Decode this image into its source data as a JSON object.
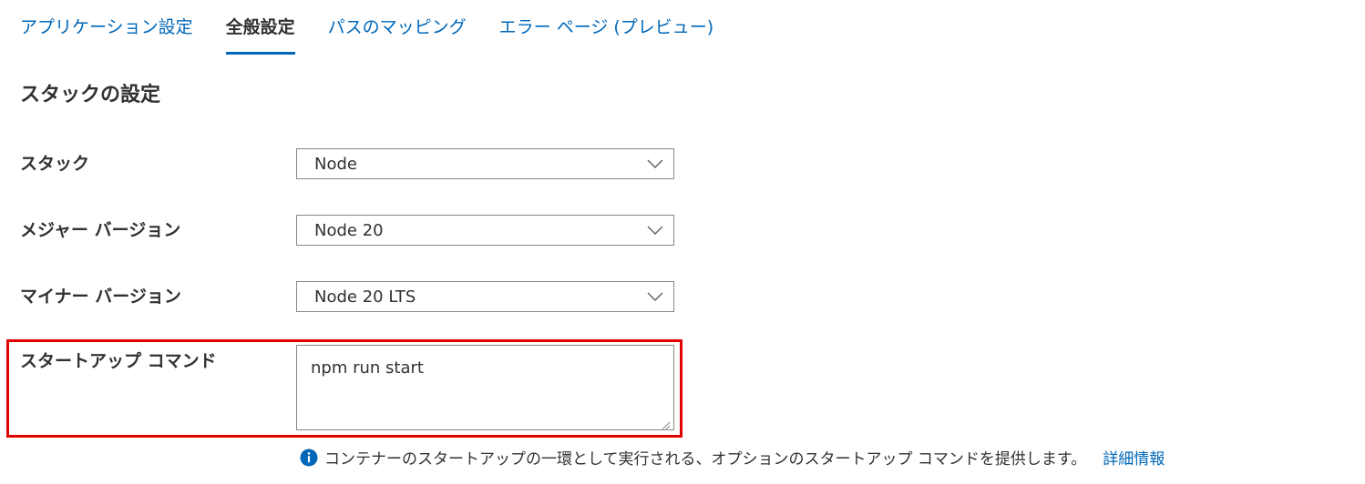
{
  "tabs": [
    {
      "label": "アプリケーション設定",
      "active": false
    },
    {
      "label": "全般設定",
      "active": true
    },
    {
      "label": "パスのマッピング",
      "active": false
    },
    {
      "label": "エラー ページ (プレビュー)",
      "active": false
    }
  ],
  "section_title": "スタックの設定",
  "fields": {
    "stack": {
      "label": "スタック",
      "value": "Node"
    },
    "major_version": {
      "label": "メジャー バージョン",
      "value": "Node 20"
    },
    "minor_version": {
      "label": "マイナー バージョン",
      "value": "Node 20 LTS"
    },
    "startup_command": {
      "label": "スタートアップ コマンド",
      "value": "npm run start"
    }
  },
  "info": {
    "text": "コンテナーのスタートアップの一環として実行される、オプションのスタートアップ コマンドを提供します。",
    "link": "詳細情報",
    "icon": "info-icon"
  },
  "colors": {
    "accent": "#0067b8",
    "highlight": "#e00000",
    "text": "#323130",
    "border": "#8a8886"
  }
}
